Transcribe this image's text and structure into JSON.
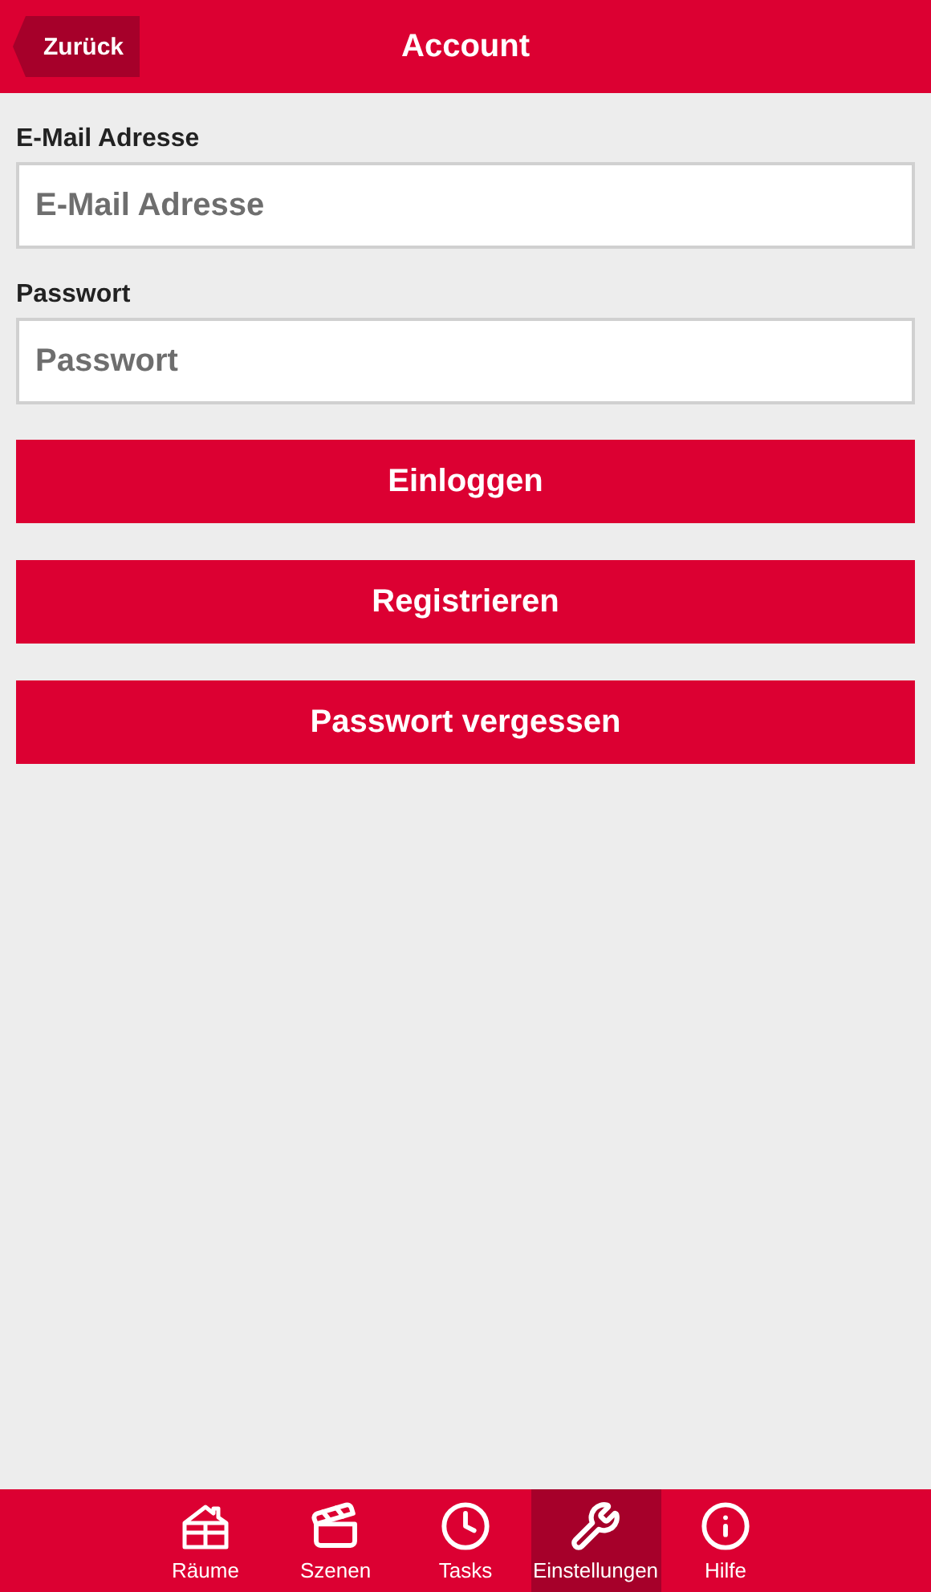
{
  "header": {
    "back": "Zurück",
    "title": "Account"
  },
  "fields": [
    {
      "label": "E-Mail Adresse",
      "placeholder": "E-Mail Adresse"
    },
    {
      "label": "Passwort",
      "placeholder": "Passwort"
    }
  ],
  "buttons": [
    "Einloggen",
    "Registrieren",
    "Passwort vergessen"
  ],
  "tabs": [
    {
      "label": "Räume",
      "selected": false
    },
    {
      "label": "Szenen",
      "selected": false
    },
    {
      "label": "Tasks",
      "selected": false
    },
    {
      "label": "Einstellungen",
      "selected": true
    },
    {
      "label": "Hilfe",
      "selected": false
    }
  ]
}
